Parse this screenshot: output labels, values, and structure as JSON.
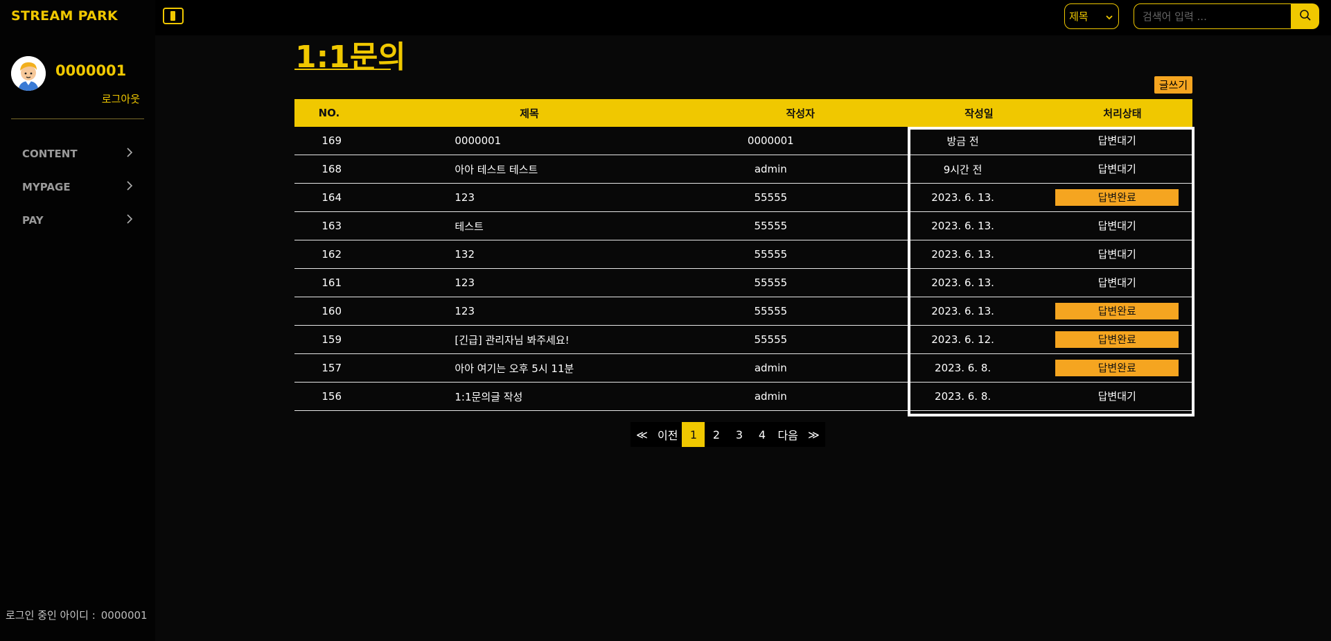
{
  "brand": "STREAM PARK",
  "user": {
    "name": "0000001",
    "logout_label": "로그아웃"
  },
  "nav": [
    {
      "label": "CONTENT"
    },
    {
      "label": "MYPAGE"
    },
    {
      "label": "PAY"
    }
  ],
  "footer": {
    "login_label": "로그인 중인 아이디 :",
    "login_id": "0000001"
  },
  "search": {
    "select_value": "제목",
    "placeholder": "검색어 입력 ..."
  },
  "page": {
    "title": "1:1문의",
    "write_label": "글쓰기"
  },
  "table": {
    "headers": {
      "no": "NO.",
      "title": "제목",
      "author": "작성자",
      "date": "작성일",
      "status": "처리상태"
    },
    "rows": [
      {
        "no": "169",
        "title": "0000001",
        "author": "0000001",
        "date": "방금 전",
        "status": "답변대기",
        "done": false
      },
      {
        "no": "168",
        "title": "아아 테스트 테스트",
        "author": "admin",
        "date": "9시간 전",
        "status": "답변대기",
        "done": false
      },
      {
        "no": "164",
        "title": "123",
        "author": "55555",
        "date": "2023. 6. 13.",
        "status": "답변완료",
        "done": true
      },
      {
        "no": "163",
        "title": "테스트",
        "author": "55555",
        "date": "2023. 6. 13.",
        "status": "답변대기",
        "done": false
      },
      {
        "no": "162",
        "title": "132",
        "author": "55555",
        "date": "2023. 6. 13.",
        "status": "답변대기",
        "done": false
      },
      {
        "no": "161",
        "title": "123",
        "author": "55555",
        "date": "2023. 6. 13.",
        "status": "답변대기",
        "done": false
      },
      {
        "no": "160",
        "title": "123",
        "author": "55555",
        "date": "2023. 6. 13.",
        "status": "답변완료",
        "done": true
      },
      {
        "no": "159",
        "title": "[긴급] 관리자님 봐주세요!",
        "author": "55555",
        "date": "2023. 6. 12.",
        "status": "답변완료",
        "done": true
      },
      {
        "no": "157",
        "title": "아아 여기는 오후 5시 11분",
        "author": "admin",
        "date": "2023. 6. 8.",
        "status": "답변완료",
        "done": true
      },
      {
        "no": "156",
        "title": "1:1문의글 작성",
        "author": "admin",
        "date": "2023. 6. 8.",
        "status": "답변대기",
        "done": false
      }
    ]
  },
  "pagination": {
    "first": "≪",
    "prev": "이전",
    "pages": [
      "1",
      "2",
      "3",
      "4"
    ],
    "current": "1",
    "next": "다음",
    "last": "≫"
  },
  "colors": {
    "accent": "#f0c800",
    "done_badge": "#f5a520",
    "background": "#080808"
  }
}
